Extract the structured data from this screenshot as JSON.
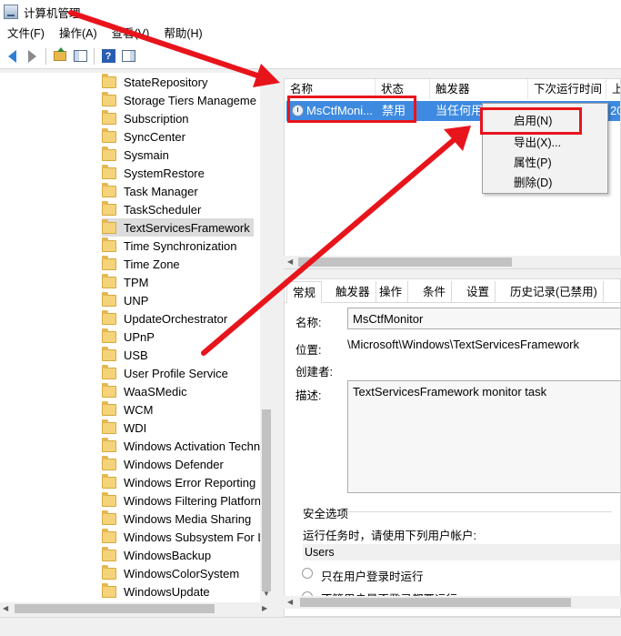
{
  "window": {
    "title": "计算机管理"
  },
  "menubar": {
    "items": [
      "文件(F)",
      "操作(A)",
      "查看(V)",
      "帮助(H)"
    ]
  },
  "toolbar": {
    "help_label": "?"
  },
  "tree": {
    "items": [
      "StateRepository",
      "Storage Tiers Manageme",
      "Subscription",
      "SyncCenter",
      "Sysmain",
      "SystemRestore",
      "Task Manager",
      "TaskScheduler",
      "TextServicesFramework",
      "Time Synchronization",
      "Time Zone",
      "TPM",
      "UNP",
      "UpdateOrchestrator",
      "UPnP",
      "USB",
      "User Profile Service",
      "WaaSMedic",
      "WCM",
      "WDI",
      "Windows Activation Techn",
      "Windows Defender",
      "Windows Error Reporting",
      "Windows Filtering Platforn",
      "Windows Media Sharing",
      "Windows Subsystem For L",
      "WindowsBackup",
      "WindowsColorSystem",
      "WindowsUpdate"
    ],
    "selected": "TextServicesFramework"
  },
  "task_list": {
    "columns": [
      "名称",
      "状态",
      "触发器",
      "下次运行时间",
      "上"
    ],
    "row": {
      "name": "MsCtfMoni...",
      "status": "禁用",
      "trigger": "当任何用户登录时",
      "extra": "20"
    }
  },
  "context_menu": {
    "items": [
      "启用(N)",
      "导出(X)...",
      "属性(P)",
      "删除(D)"
    ]
  },
  "details": {
    "tabs": [
      "常规",
      "触发器",
      "操作",
      "条件",
      "设置",
      "历史记录(已禁用)"
    ],
    "name_label": "名称:",
    "name_value": "MsCtfMonitor",
    "location_label": "位置:",
    "location_value": "\\Microsoft\\Windows\\TextServicesFramework",
    "author_label": "创建者:",
    "desc_label": "描述:",
    "desc_value": "TextServicesFramework monitor task",
    "security_title": "安全选项",
    "run_as_text": "运行任务时，请使用下列用户帐户:",
    "user_value": "Users",
    "radio_1": "只在用户登录时运行",
    "radio_2": "不管用户是否登录都要运行"
  },
  "colors": {
    "selection": "#3e8ae0",
    "annotation": "#e8141c"
  }
}
